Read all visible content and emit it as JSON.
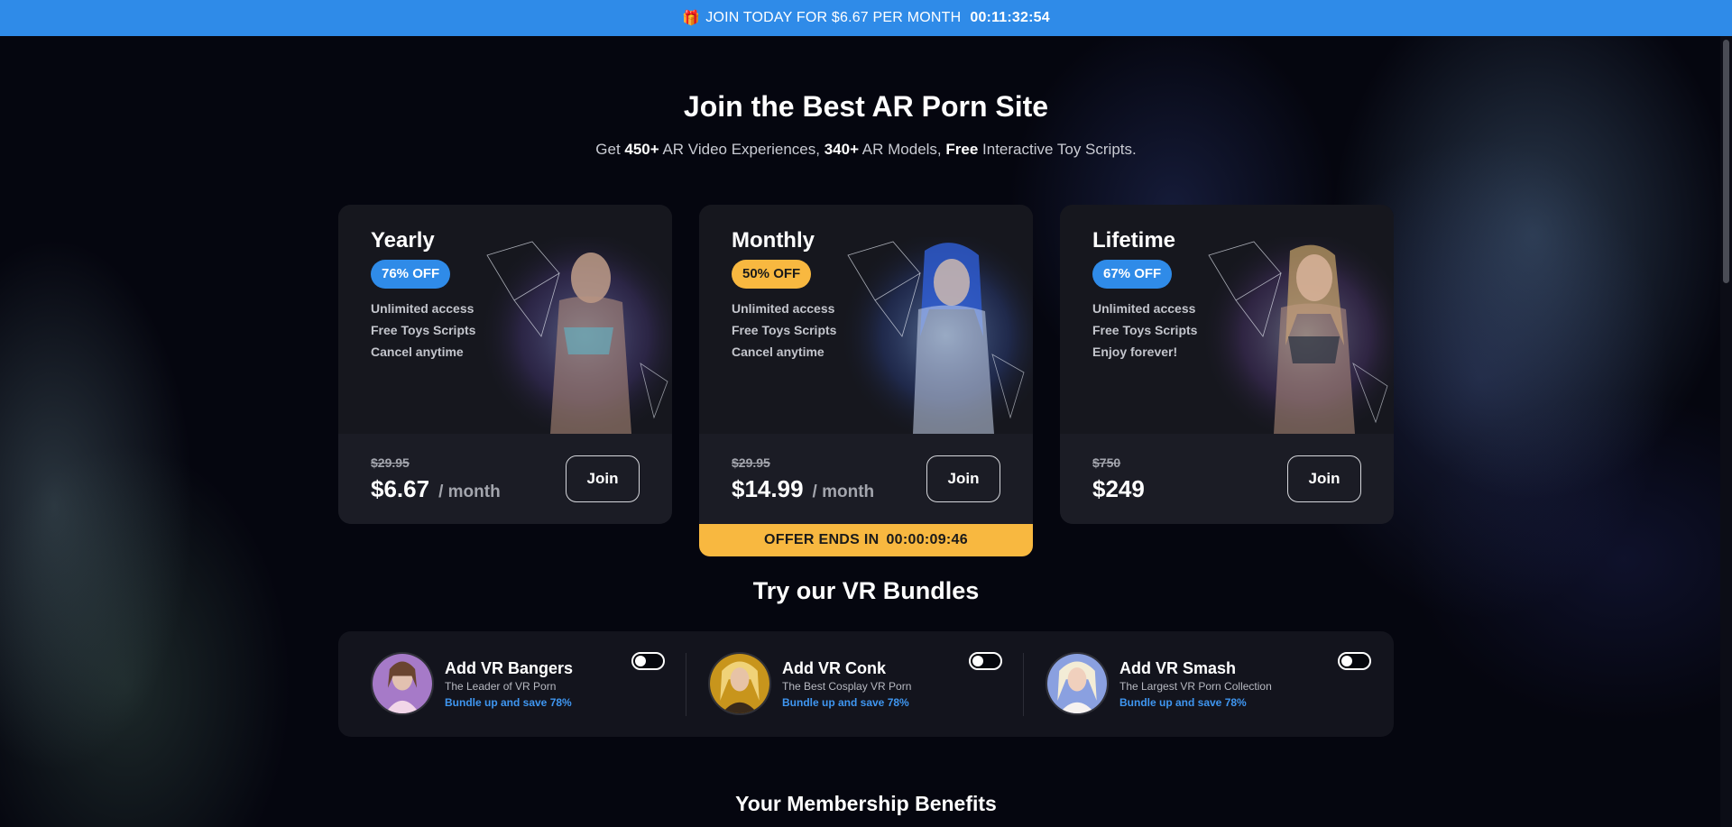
{
  "topbar": {
    "icon": "gift-icon",
    "text": "JOIN TODAY FOR $6.67 PER MONTH",
    "timer": "00:11:32:54",
    "color": "#2f8be8"
  },
  "hero": {
    "title": "Join the Best AR Porn Site",
    "sub": {
      "t1": "Get ",
      "b1": "450+",
      "t2": " AR Video Experiences, ",
      "b2": "340+",
      "t3": " AR Models, ",
      "b3": "Free",
      "t4": " Interactive Toy Scripts."
    }
  },
  "plans": [
    {
      "title": "Yearly",
      "badge": "76% OFF",
      "badge_color": "#2f8be8",
      "features": [
        "Unlimited access",
        "Free Toys Scripts",
        "Cancel anytime"
      ],
      "old_price": "$29.95",
      "price": "$6.67",
      "per": "/ month",
      "join_label": "Join"
    },
    {
      "title": "Monthly",
      "badge": "50% OFF",
      "badge_color": "#f8b840",
      "features": [
        "Unlimited access",
        "Free Toys Scripts",
        "Cancel anytime"
      ],
      "old_price": "$29.95",
      "price": "$14.99",
      "per": "/ month",
      "join_label": "Join"
    },
    {
      "title": "Lifetime",
      "badge": "67% OFF",
      "badge_color": "#2f8be8",
      "features": [
        "Unlimited access",
        "Free Toys Scripts",
        "Enjoy forever!"
      ],
      "old_price": "$750",
      "price": "$249",
      "per": "",
      "join_label": "Join"
    }
  ],
  "offer": {
    "label": "OFFER ENDS IN",
    "timer": "00:00:09:46",
    "color": "#f8b840"
  },
  "bundles": {
    "title": "Try our VR Bundles",
    "items": [
      {
        "name": "Add VR Bangers",
        "tagline": "The Leader of VR Porn",
        "save": "Bundle up and save 78%",
        "enabled": false
      },
      {
        "name": "Add VR Conk",
        "tagline": "The Best Cosplay VR Porn",
        "save": "Bundle up and save 78%",
        "enabled": false
      },
      {
        "name": "Add VR Smash",
        "tagline": "The Largest VR Porn Collection",
        "save": "Bundle up and save 78%",
        "enabled": false
      }
    ]
  },
  "benefits": {
    "title": "Your Membership Benefits"
  }
}
